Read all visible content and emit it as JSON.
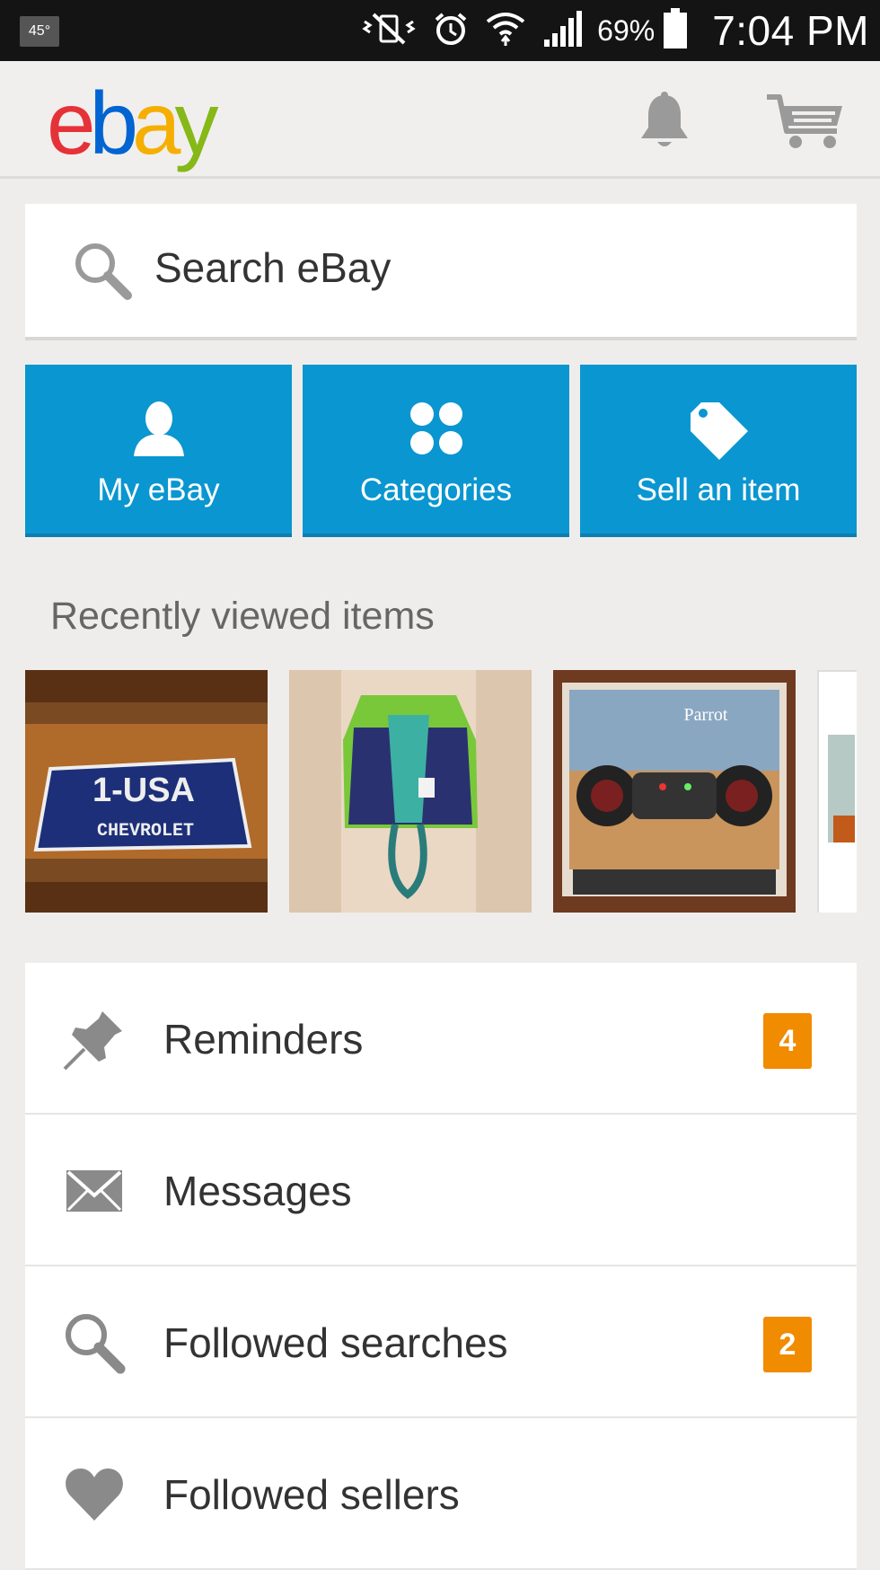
{
  "status_bar": {
    "temperature": "45°",
    "battery": "69%",
    "time": "7:04 PM",
    "icons": [
      "mute-vibrate-icon",
      "alarm-icon",
      "wifi-icon",
      "signal-icon",
      "battery-icon"
    ]
  },
  "app_bar": {
    "logo": {
      "e": "e",
      "b": "b",
      "a": "a",
      "y": "y"
    },
    "logo_colors": [
      "#e53238",
      "#0064d2",
      "#f5af02",
      "#86b817"
    ],
    "icons": [
      "bell-icon",
      "cart-icon"
    ]
  },
  "search": {
    "placeholder": "Search eBay",
    "icon": "search-icon"
  },
  "tiles": [
    {
      "label": "My eBay",
      "icon": "person-icon"
    },
    {
      "label": "Categories",
      "icon": "grid-dots-icon"
    },
    {
      "label": "Sell an item",
      "icon": "tag-icon"
    }
  ],
  "tile_color": "#0a96d0",
  "recently_viewed": {
    "title": "Recently viewed items",
    "items": [
      {
        "image": "license-plate-photo",
        "plate_line1": "1-USA",
        "plate_line2": "CHEVROLET"
      },
      {
        "image": "swim-vest-photo"
      },
      {
        "image": "drone-box-photo",
        "box_brand": "Parrot"
      },
      {
        "image": "partial-item-photo"
      }
    ]
  },
  "menu": [
    {
      "label": "Reminders",
      "icon": "pin-icon",
      "badge": "4"
    },
    {
      "label": "Messages",
      "icon": "envelope-icon",
      "badge": null
    },
    {
      "label": "Followed searches",
      "icon": "search-icon",
      "badge": "2"
    },
    {
      "label": "Followed sellers",
      "icon": "heart-icon",
      "badge": null
    }
  ],
  "badge_color": "#f18b00"
}
